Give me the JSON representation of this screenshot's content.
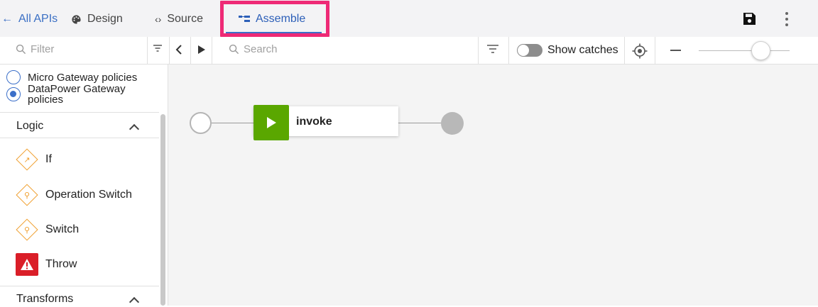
{
  "header": {
    "back_label": "All APIs",
    "tabs": [
      {
        "label": "Design",
        "icon": "palette-icon"
      },
      {
        "label": "Source",
        "icon": "code-icon"
      },
      {
        "label": "Assemble",
        "icon": "assemble-icon",
        "active": true
      }
    ],
    "actions": [
      "save-icon",
      "more-vertical-icon"
    ],
    "accent_color": "#3b6fc9",
    "highlight_color": "#ee2a76"
  },
  "toolbar": {
    "filter_placeholder": "Filter",
    "search_placeholder": "Search",
    "show_catches_label": "Show catches",
    "show_catches_on": false,
    "zoom_level": 0.7
  },
  "sidebar": {
    "gateways": [
      {
        "label": "Micro Gateway policies",
        "selected": false
      },
      {
        "label": "DataPower Gateway policies",
        "selected": true
      }
    ],
    "sections": [
      {
        "title": "Logic",
        "expanded": true,
        "items": [
          {
            "label": "If",
            "icon": "if-diamond-icon"
          },
          {
            "label": "Operation Switch",
            "icon": "switch-diamond-icon"
          },
          {
            "label": "Switch",
            "icon": "switch-diamond-icon"
          },
          {
            "label": "Throw",
            "icon": "warning-icon",
            "color": "#da1e28"
          }
        ]
      },
      {
        "title": "Transforms",
        "expanded": true
      }
    ]
  },
  "canvas": {
    "nodes": [
      {
        "type": "start"
      },
      {
        "type": "policy",
        "label": "invoke",
        "color": "#5aa700"
      },
      {
        "type": "end"
      }
    ]
  }
}
